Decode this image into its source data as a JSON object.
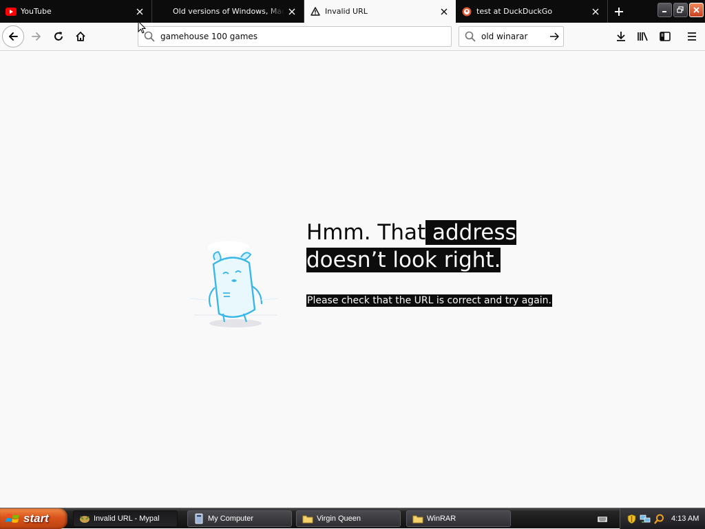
{
  "tabs": [
    {
      "title": "YouTube",
      "icon": "youtube-icon",
      "active": false
    },
    {
      "title": "Old versions of Windows, Mac and Linux",
      "icon": "none",
      "active": false
    },
    {
      "title": "Invalid URL",
      "icon": "warning-icon",
      "active": true
    },
    {
      "title": "test at DuckDuckGo",
      "icon": "duckduckgo-icon",
      "active": false
    }
  ],
  "url_bar": {
    "value": "gamehouse 100 games"
  },
  "search_bar": {
    "value": "old winarar"
  },
  "error": {
    "title_part1": "Hmm. That",
    "title_part2": " address ",
    "title_part3": "doesn’t look right.",
    "message": "Please check that the URL is correct and try again."
  },
  "taskbar": {
    "start_label": "start",
    "tasks": [
      {
        "label": "Invalid URL - Mypal",
        "icon": "browser-icon",
        "active": true
      },
      {
        "label": "My Computer",
        "icon": "computer-icon",
        "active": false
      },
      {
        "label": "Virgin Queen",
        "icon": "folder-icon",
        "active": false
      },
      {
        "label": "WinRAR",
        "icon": "folder-icon",
        "active": false
      }
    ],
    "clock": "4:13 AM"
  },
  "colors": {
    "tabstrip": "#0c0c0d",
    "page_bg": "#f9f9fa",
    "selection": "#0c0c0d",
    "start_orange": "#d9531c"
  }
}
